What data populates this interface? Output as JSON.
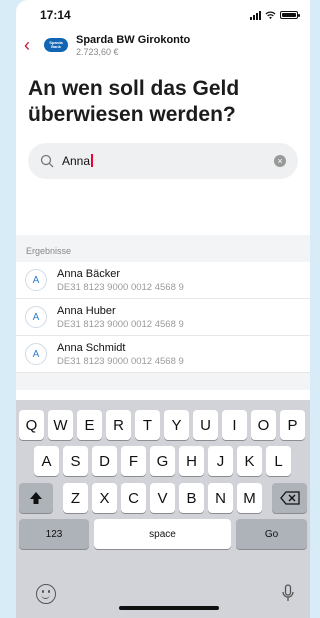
{
  "status_bar": {
    "time": "17:14"
  },
  "header": {
    "logo_text": "Sparda-Bank",
    "account_name": "Sparda BW Girokonto",
    "balance": "2.723,60 €",
    "accent_color": "#c8102e",
    "logo_color": "#1265b3"
  },
  "page": {
    "title": "An wen soll das Geld überwiesen werden?"
  },
  "search": {
    "value": "Anna"
  },
  "results": {
    "label": "Ergebnisse",
    "items": [
      {
        "initial": "A",
        "name": "Anna Bäcker",
        "iban": "DE31 8123 9000 0012 4568 9"
      },
      {
        "initial": "A",
        "name": "Anna Huber",
        "iban": "DE31 8123 9000 0012 4568 9"
      },
      {
        "initial": "A",
        "name": "Anna Schmidt",
        "iban": "DE31 8123 9000 0012 4568 9"
      }
    ]
  },
  "keyboard": {
    "row1": [
      "Q",
      "W",
      "E",
      "R",
      "T",
      "Y",
      "U",
      "I",
      "O",
      "P"
    ],
    "row2": [
      "A",
      "S",
      "D",
      "F",
      "G",
      "H",
      "J",
      "K",
      "L"
    ],
    "row3": [
      "Z",
      "X",
      "C",
      "V",
      "B",
      "N",
      "M"
    ],
    "numbers_label": "123",
    "space_label": "space",
    "go_label": "Go",
    "shift_icon": "shift-icon",
    "delete_icon": "delete-icon"
  }
}
